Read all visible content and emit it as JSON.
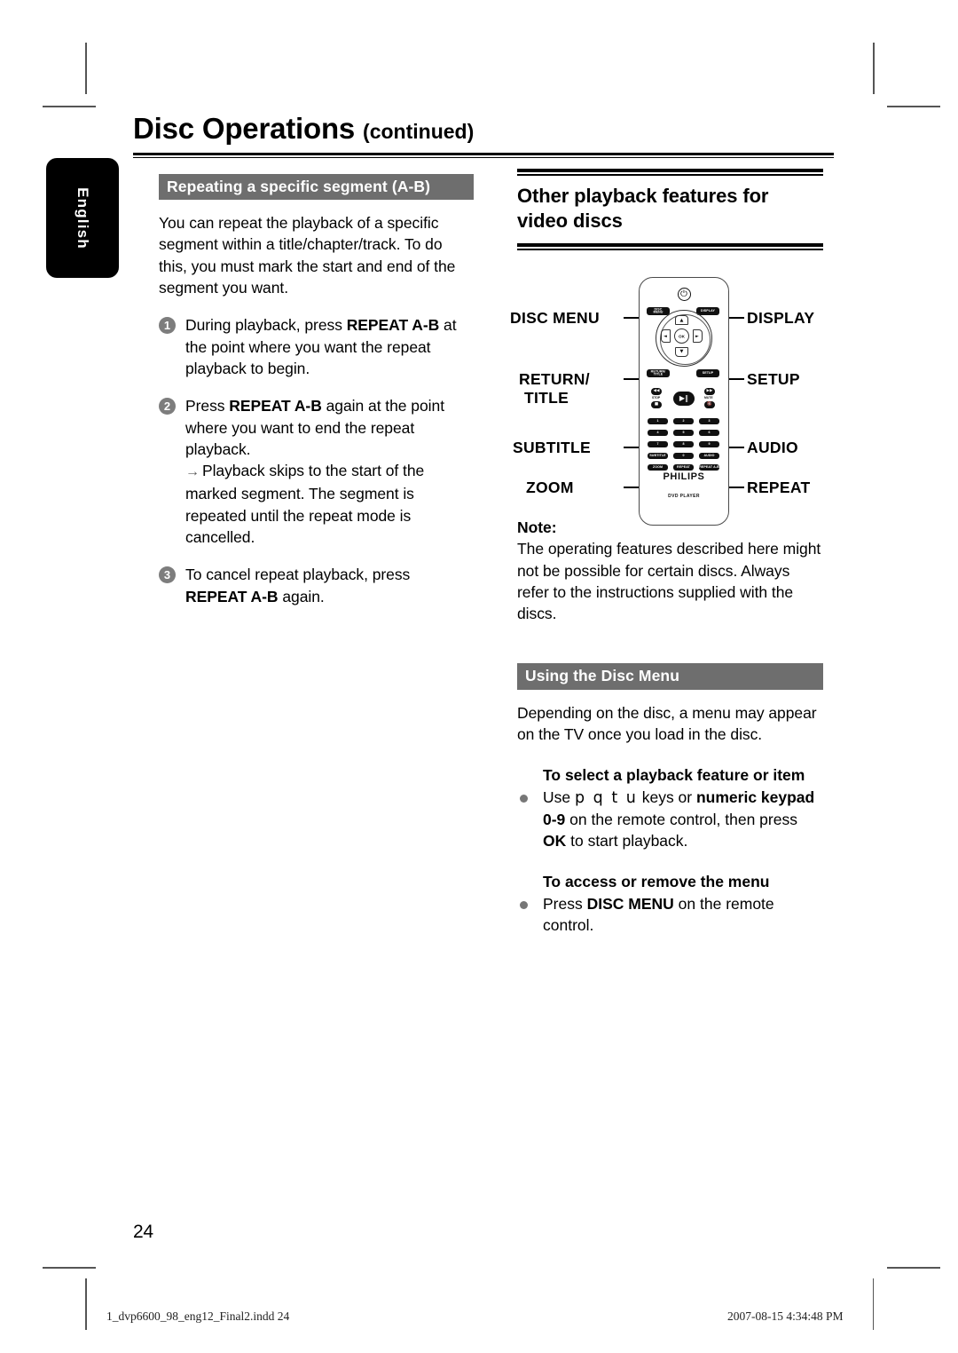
{
  "page": {
    "title_main": "Disc Operations",
    "title_continued": "(continued)",
    "page_number": "24",
    "language_tab": "English"
  },
  "left_column": {
    "section_heading": "Repeating a specific segment (A-B)",
    "intro": "You can repeat the playback of a specific segment within a title/chapter/track. To do this, you must mark the start and end of the segment you want.",
    "steps": [
      {
        "num": "1",
        "pre": "During playback, press ",
        "bold": "REPEAT A-B",
        "post": " at the point where you want the repeat playback to begin."
      },
      {
        "num": "2",
        "pre": "Press ",
        "bold": "REPEAT A-B",
        "post": " again at the point where you want to end the repeat playback.",
        "arrow_glyph": "→",
        "arrow_text": "Playback skips to the start of the marked segment. The segment is repeated until the repeat mode is cancelled."
      },
      {
        "num": "3",
        "pre": "To cancel repeat playback, press ",
        "bold": "REPEAT A-B",
        "post": " again."
      }
    ]
  },
  "right_column": {
    "main_heading": "Other playback features for video discs",
    "note_label": "Note:",
    "note_text": "The operating features described here might not be possible for certain discs. Always refer to the instructions supplied with the discs.",
    "disc_menu_heading": "Using the Disc Menu",
    "disc_menu_intro": "Depending on the disc, a menu may appear on the TV once you load in the disc.",
    "select_subhead": "To select a playback feature or item",
    "select_bullet": {
      "pre": "Use ",
      "keys": "p q t  u",
      "mid": " keys or ",
      "bold1": "numeric keypad 0-9",
      "post1": " on the remote control, then press ",
      "bold2": "OK",
      "post2": " to start playback."
    },
    "access_subhead": "To access or remove the menu",
    "access_bullet": {
      "pre": "Press ",
      "bold": "DISC MENU",
      "post": " on the remote control."
    }
  },
  "remote": {
    "callouts_left": [
      {
        "label": "DISC MENU"
      },
      {
        "label": "RETURN/"
      },
      {
        "label": "TITLE"
      },
      {
        "label": "SUBTITLE"
      },
      {
        "label": "ZOOM"
      }
    ],
    "callouts_right": [
      {
        "label": "DISPLAY"
      },
      {
        "label": "SETUP"
      },
      {
        "label": "AUDIO"
      },
      {
        "label": "REPEAT"
      }
    ],
    "brand": "PHILIPS",
    "sub_brand": "DVD PLAYER",
    "keys": {
      "disc_menu_l1": "DISC",
      "disc_menu_l2": "MENU",
      "display": "DISPLAY",
      "return_l1": "RETURN/",
      "return_l2": "TITLE",
      "setup": "SETUP",
      "ok": "OK",
      "up": "▲",
      "down": "▼",
      "left": "◄",
      "right": "►",
      "power": "⏻",
      "playpause": "▶‖",
      "prev": "◀◀",
      "next": "▶▶",
      "stop_lbl": "STOP",
      "stop_glyph": "■",
      "mute_lbl": "MUTE",
      "mute_glyph": "🔇",
      "subtitle": "SUBTITLE",
      "audio": "AUDIO",
      "zoom": "ZOOM",
      "repeat": "REPEAT",
      "repeat_ab": "REPEAT A-B",
      "numbers": [
        "1",
        "2",
        "3",
        "4",
        "5",
        "6",
        "7",
        "8",
        "9",
        "0"
      ]
    }
  },
  "footer": {
    "filename": "1_dvp6600_98_eng12_Final2.indd   24",
    "timestamp": "2007-08-15   4:34:48 PM"
  }
}
